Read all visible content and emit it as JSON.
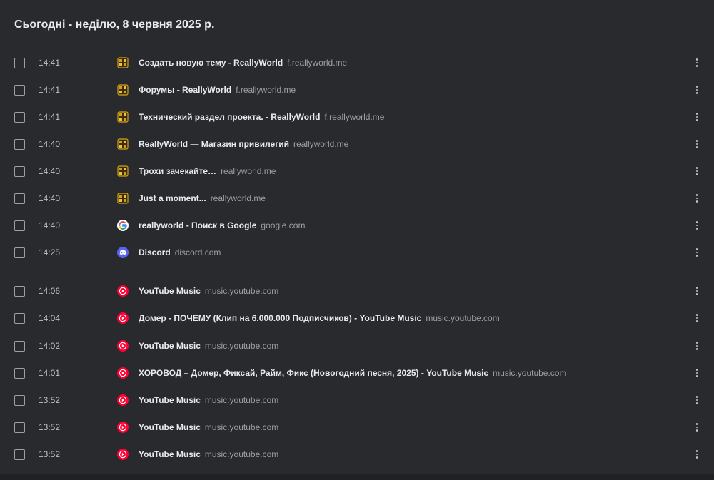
{
  "header": {
    "date_title": "Сьогодні - неділю, 8 червня 2025 р."
  },
  "colors": {
    "background": "#292a2d",
    "text_primary": "#e8eaed",
    "text_secondary": "#9aa0a6",
    "youtube_music_red": "#ff0033",
    "discord_blue": "#5865f2",
    "reallyworld_gold": "#d4a017"
  },
  "history": [
    {
      "time": "14:41",
      "icon": "reallyworld-icon",
      "title": "Создать новую тему - ReallyWorld",
      "domain": "f.reallyworld.me"
    },
    {
      "time": "14:41",
      "icon": "reallyworld-icon",
      "title": "Форумы - ReallyWorld",
      "domain": "f.reallyworld.me"
    },
    {
      "time": "14:41",
      "icon": "reallyworld-icon",
      "title": "Технический раздел проекта. - ReallyWorld",
      "domain": "f.reallyworld.me"
    },
    {
      "time": "14:40",
      "icon": "reallyworld-icon",
      "title": "ReallyWorld — Магазин привилегий",
      "domain": "reallyworld.me"
    },
    {
      "time": "14:40",
      "icon": "reallyworld-icon",
      "title": "Трохи зачекайте…",
      "domain": "reallyworld.me"
    },
    {
      "time": "14:40",
      "icon": "reallyworld-icon",
      "title": "Just a moment...",
      "domain": "reallyworld.me"
    },
    {
      "time": "14:40",
      "icon": "google-icon",
      "title": "reallyworld - Поиск в Google",
      "domain": "google.com"
    },
    {
      "time": "14:25",
      "icon": "discord-icon",
      "title": "Discord",
      "domain": "discord.com"
    },
    {
      "time": "14:06",
      "icon": "youtube-music-icon",
      "title": "YouTube Music",
      "domain": "music.youtube.com"
    },
    {
      "time": "14:04",
      "icon": "youtube-music-icon",
      "title": "Домер - ПОЧЕМУ (Клип на 6.000.000 Подписчиков) - YouTube Music",
      "domain": "music.youtube.com"
    },
    {
      "time": "14:02",
      "icon": "youtube-music-icon",
      "title": "YouTube Music",
      "domain": "music.youtube.com"
    },
    {
      "time": "14:01",
      "icon": "youtube-music-icon",
      "title": "ХОРОВОД – Домер, Фиксай, Райм, Фикс (Новогодний песня, 2025) - YouTube Music",
      "domain": "music.youtube.com"
    },
    {
      "time": "13:52",
      "icon": "youtube-music-icon",
      "title": "YouTube Music",
      "domain": "music.youtube.com"
    },
    {
      "time": "13:52",
      "icon": "youtube-music-icon",
      "title": "YouTube Music",
      "domain": "music.youtube.com"
    },
    {
      "time": "13:52",
      "icon": "youtube-music-icon",
      "title": "YouTube Music",
      "domain": "music.youtube.com"
    }
  ]
}
